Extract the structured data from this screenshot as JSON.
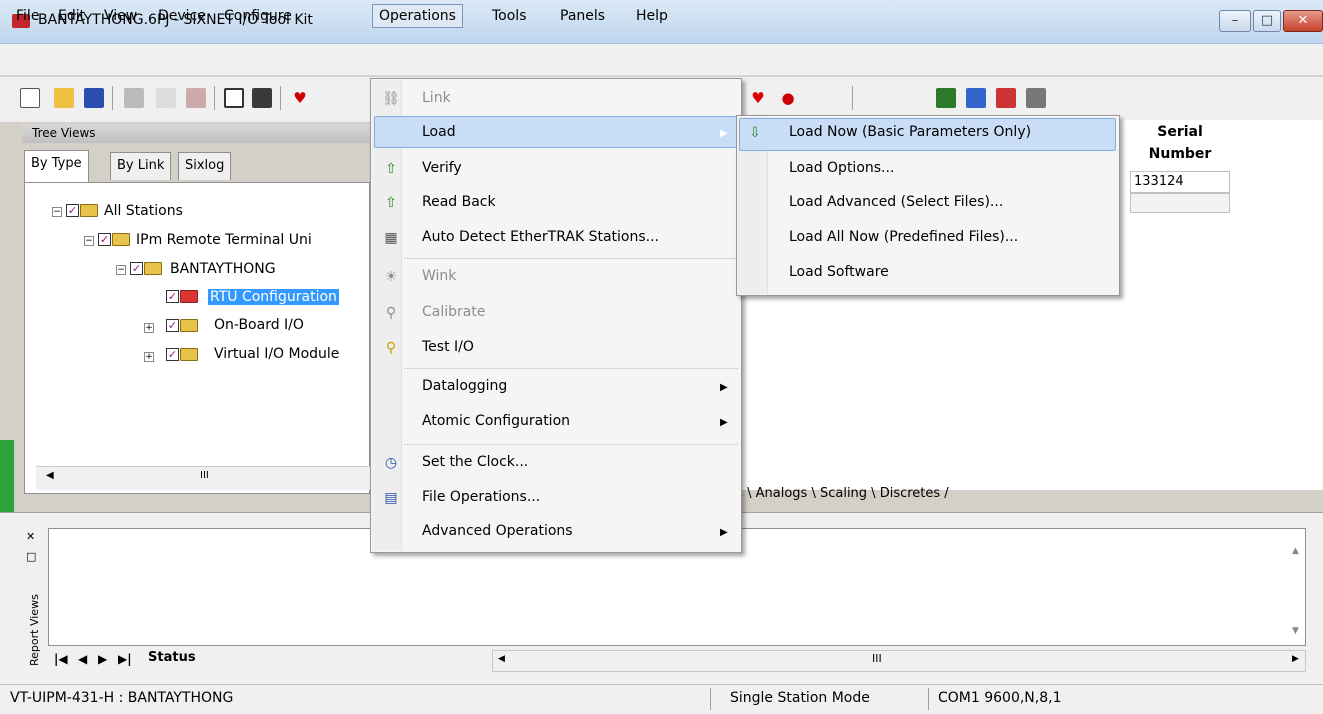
{
  "window": {
    "title": "BANTAYTHONG.6PJ - SIXNET I/O Tool Kit",
    "minimize": "–",
    "maximize": "□",
    "close": "✕"
  },
  "menubar": [
    "File",
    "Edit",
    "View",
    "Device",
    "Configure",
    "Operations",
    "Tools",
    "Panels",
    "Help"
  ],
  "tree": {
    "header": "Tree Views",
    "tabs": [
      "By Type",
      "By Link",
      "Sixlog"
    ],
    "nodes": [
      "All Stations",
      "IPm Remote Terminal Uni",
      "BANTAYTHONG",
      "RTU Configuration",
      "On-Board I/O",
      "Virtual I/O Module"
    ],
    "scroll_thumb": "III"
  },
  "table": {
    "serial_header_1": "Serial",
    "serial_header_2": "Number",
    "serial_value": "133124"
  },
  "sheet_tabs": "ags \\ Analogs \\ Scaling \\ Discretes /",
  "operations_menu": {
    "link": "Link",
    "load": "Load",
    "verify": "Verify",
    "read_back": "Read Back",
    "auto_detect": "Auto Detect EtherTRAK Stations...",
    "wink": "Wink",
    "calibrate": "Calibrate",
    "test_io": "Test I/O",
    "datalogging": "Datalogging",
    "atomic": "Atomic Configuration",
    "set_clock": "Set the Clock...",
    "file_ops": "File Operations...",
    "advanced": "Advanced Operations"
  },
  "load_submenu": {
    "load_now": "Load Now (Basic Parameters Only)",
    "load_options": "Load Options...",
    "load_advanced": "Load Advanced (Select Files)...",
    "load_all_now": "Load All Now (Predefined Files)...",
    "load_software": "Load Software"
  },
  "report": {
    "side_label": "Report Views",
    "tab": "Status",
    "hscroll_thumb": "III"
  },
  "statusbar": {
    "device": "VT-UIPM-431-H : BANTAYTHONG",
    "mode": "Single Station Mode",
    "port": "COM1 9600,N,8,1"
  },
  "colors": {
    "highlight": "#c9def6",
    "selection": "#3399ff",
    "checkmark": "#9d118d"
  }
}
